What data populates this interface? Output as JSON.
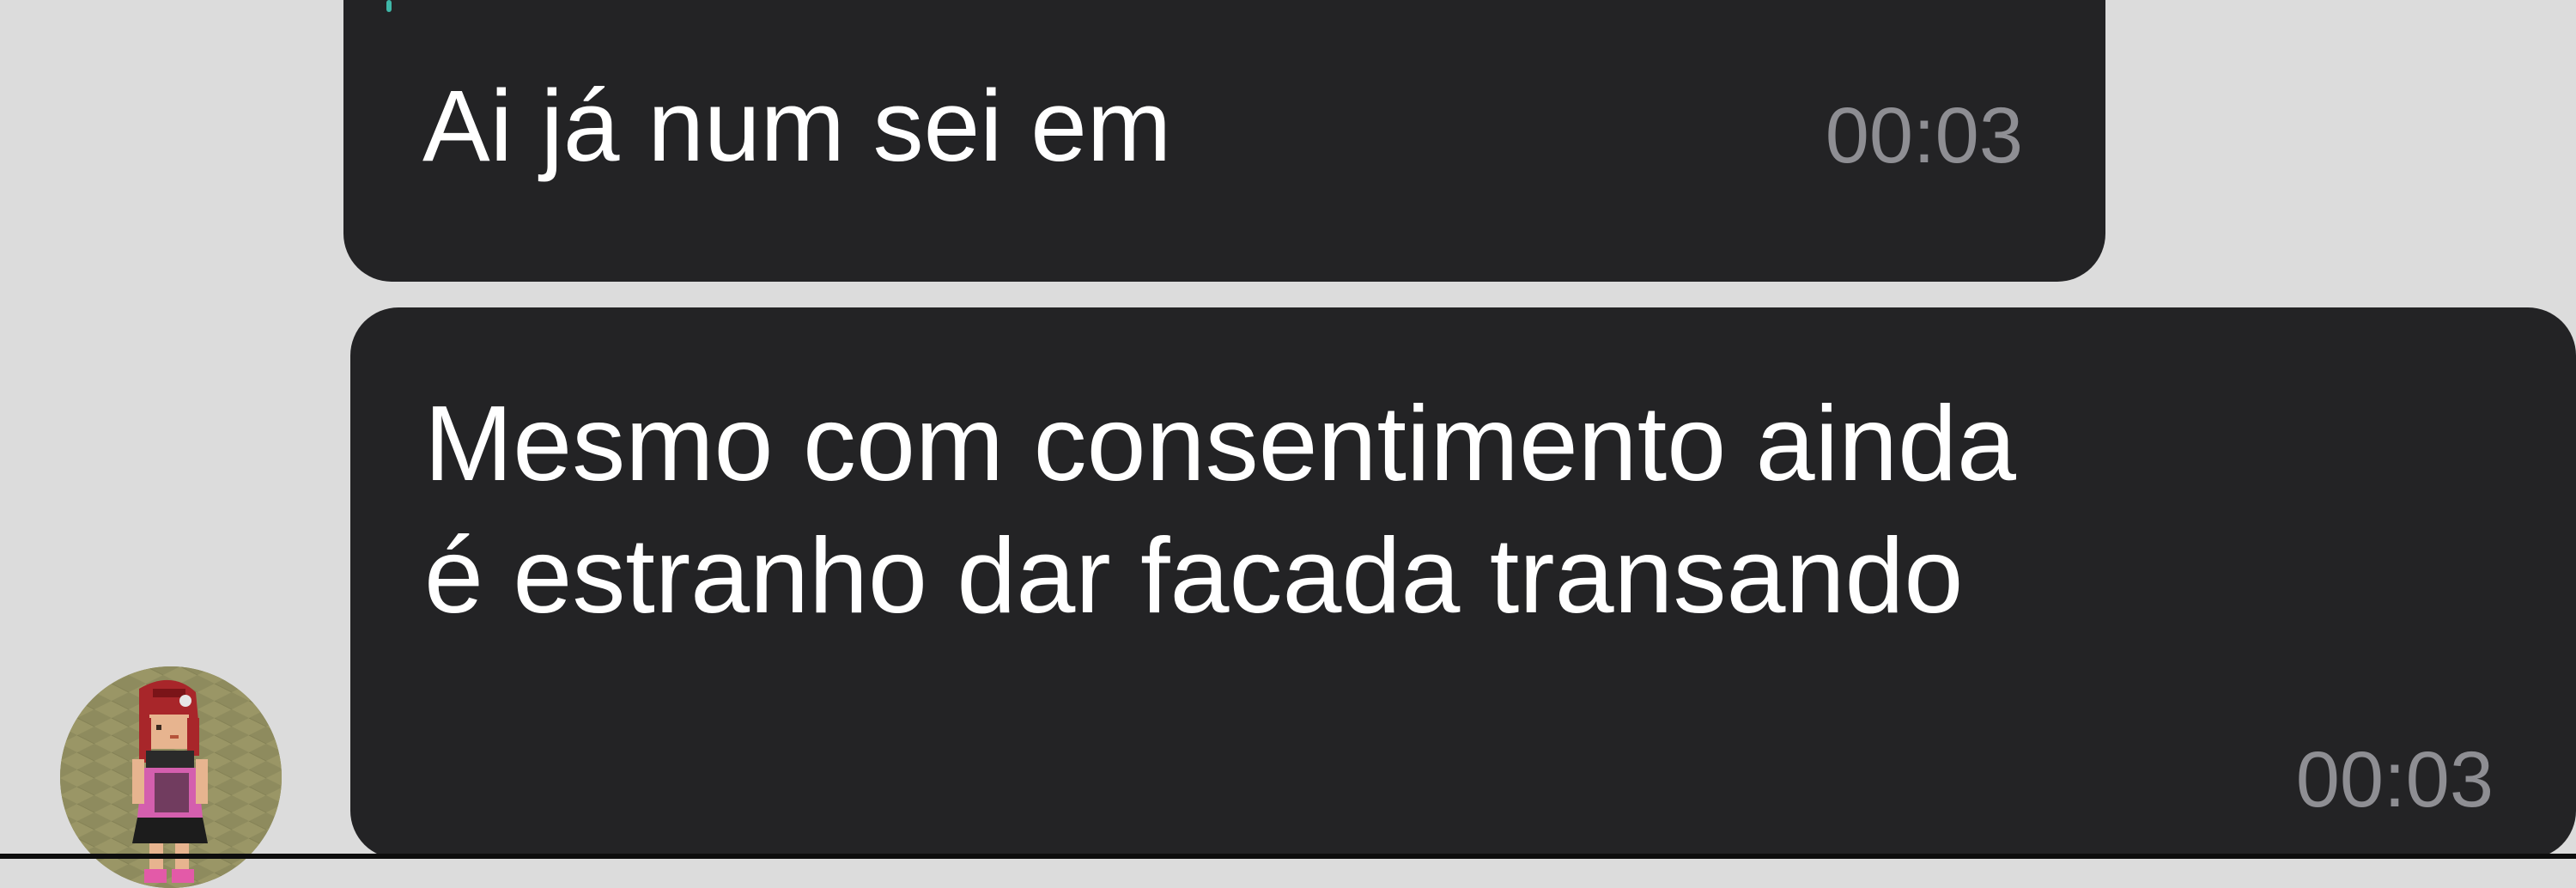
{
  "messages": [
    {
      "text": "Ai já num sei em",
      "time": "00:03"
    },
    {
      "lines": [
        "Mesmo com consentimento ainda",
        "é estranho dar facada transando"
      ],
      "time": "00:03"
    }
  ],
  "avatar": {
    "icon": "habbo-avatar-icon"
  },
  "colors": {
    "background": "#dcdcdc",
    "bubble": "#232325",
    "timestamp": "#8e8e93",
    "reply_accent": "#3fb7a8"
  }
}
